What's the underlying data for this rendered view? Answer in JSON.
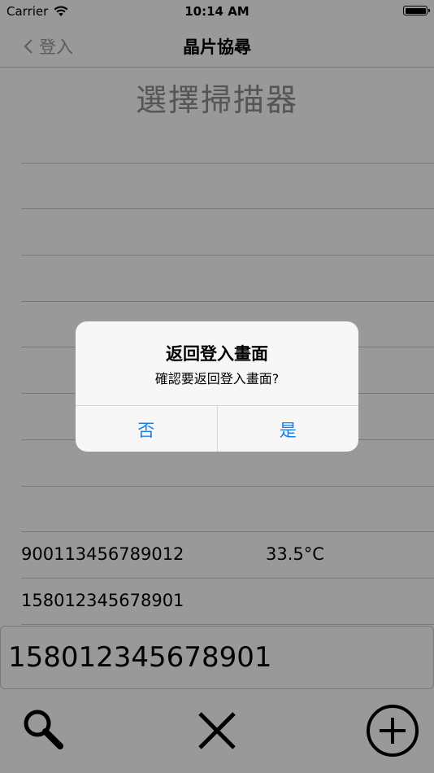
{
  "status_bar": {
    "carrier": "Carrier",
    "time": "10:14 AM"
  },
  "nav": {
    "back_label": "登入",
    "title": "晶片協尋"
  },
  "page_title": "選擇掃描器",
  "list_rows": [
    {
      "id": "",
      "temp": ""
    },
    {
      "id": "",
      "temp": ""
    },
    {
      "id": "",
      "temp": ""
    },
    {
      "id": "",
      "temp": ""
    },
    {
      "id": "",
      "temp": ""
    },
    {
      "id": "",
      "temp": ""
    },
    {
      "id": "",
      "temp": ""
    },
    {
      "id": "",
      "temp": ""
    },
    {
      "id": "",
      "temp": ""
    },
    {
      "id": "900113456789012",
      "temp": "33.5°C"
    },
    {
      "id": "158012345678901",
      "temp": ""
    }
  ],
  "input": {
    "value": "158012345678901"
  },
  "toolbar": {
    "icons": [
      "search-icon",
      "close-icon",
      "add-circle-icon"
    ]
  },
  "alert": {
    "title": "返回登入畫面",
    "message": "確認要返回登入畫面?",
    "cancel_label": "否",
    "confirm_label": "是"
  },
  "colors": {
    "alert_button": "#1a7ee6",
    "overlay": "rgba(0,0,0,0.40)"
  }
}
